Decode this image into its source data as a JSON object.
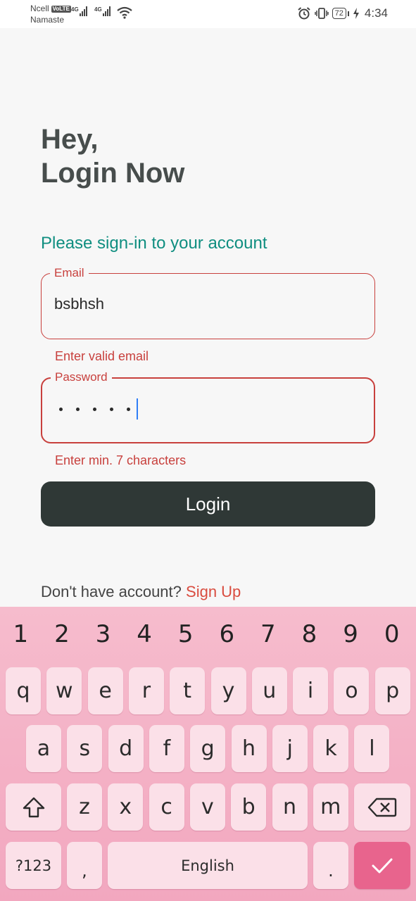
{
  "status_bar": {
    "carrier_line1": "Ncell",
    "volte": "VoLTE",
    "carrier_line2": "Namaste",
    "net_type_1": "4G",
    "net_type_2": "4G",
    "battery": "72",
    "time": "4:34"
  },
  "heading": {
    "line1": "Hey,",
    "line2": "Login Now"
  },
  "subtitle": "Please sign-in to your account",
  "email_field": {
    "label": "Email",
    "value": "bsbhsh",
    "error": "Enter valid email"
  },
  "password_field": {
    "label": "Password",
    "masked_length": 5,
    "error": "Enter min. 7 characters"
  },
  "login_button": "Login",
  "signup": {
    "prompt": "Don't have account?",
    "link": "Sign Up"
  },
  "keyboard": {
    "number_row": [
      "1",
      "2",
      "3",
      "4",
      "5",
      "6",
      "7",
      "8",
      "9",
      "0"
    ],
    "row1": [
      "q",
      "w",
      "e",
      "r",
      "t",
      "y",
      "u",
      "i",
      "o",
      "p"
    ],
    "row2": [
      "a",
      "s",
      "d",
      "f",
      "g",
      "h",
      "j",
      "k",
      "l"
    ],
    "row3": [
      "z",
      "x",
      "c",
      "v",
      "b",
      "n",
      "m"
    ],
    "symbols_key": "?123",
    "comma_key": ",",
    "space_key": "English",
    "period_key": ".",
    "colors": {
      "background": "#f4b3c7",
      "key": "#fbe0e8",
      "enter": "#e8648d"
    }
  },
  "colors": {
    "accent": "#0f8e80",
    "error": "#c8403d",
    "button": "#2f3836",
    "link": "#d94c3f"
  }
}
